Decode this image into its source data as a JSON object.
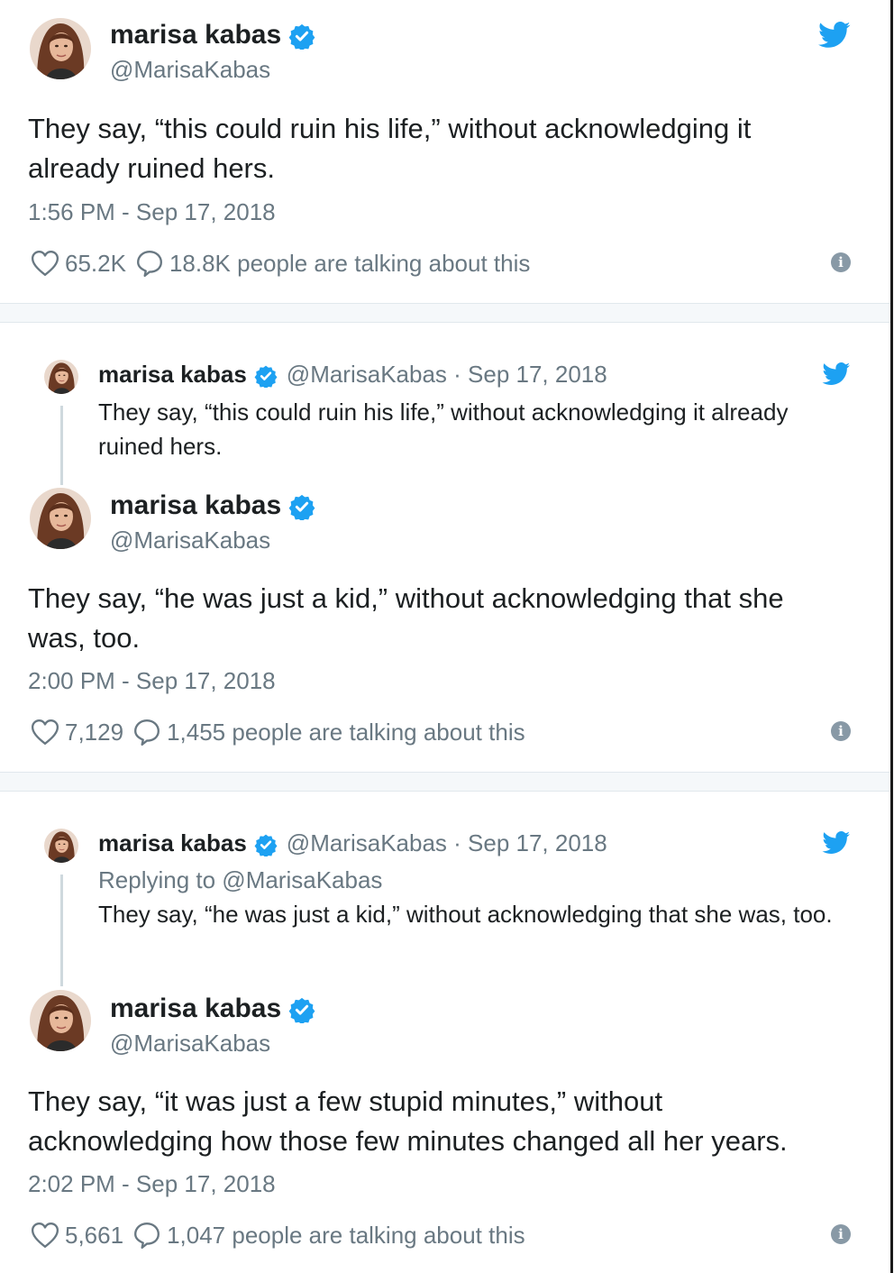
{
  "colors": {
    "verified": "#1da1f2",
    "twitter_blue": "#1da1f2",
    "muted": "#697882",
    "text": "#1c2022",
    "separator": "#f5f8fa"
  },
  "tweet1": {
    "name": "marisa kabas",
    "handle": "@MarisaKabas",
    "text": "They say, “this could ruin his life,” without acknowledging it already ruined hers.",
    "time": "1:56 PM - Sep 17, 2018",
    "likes": "65.2K",
    "talking": "18.8K people are talking about this"
  },
  "quote1": {
    "name": "marisa kabas",
    "handle_date": "@MarisaKabas · Sep 17, 2018",
    "text": "They say, “this could ruin his life,” without acknowledging it already ruined hers."
  },
  "tweet2": {
    "name": "marisa kabas",
    "handle": "@MarisaKabas",
    "text": "They say, “he was just a kid,” without acknowledging that she was, too.",
    "time": "2:00 PM - Sep 17, 2018",
    "likes": "7,129",
    "talking": "1,455 people are talking about this"
  },
  "quote2": {
    "name": "marisa kabas",
    "handle_date": "@MarisaKabas · Sep 17, 2018",
    "replying": "Replying to @MarisaKabas",
    "text": "They say, “he was just a kid,” without acknowledging that she was, too."
  },
  "tweet3": {
    "name": "marisa kabas",
    "handle": "@MarisaKabas",
    "text": "They say, “it was just a few stupid minutes,” without acknowledging how those few minutes changed all her years.",
    "time": "2:02 PM - Sep 17, 2018",
    "likes": "5,661",
    "talking": "1,047 people are talking about this"
  },
  "icons": {
    "info": "i"
  }
}
